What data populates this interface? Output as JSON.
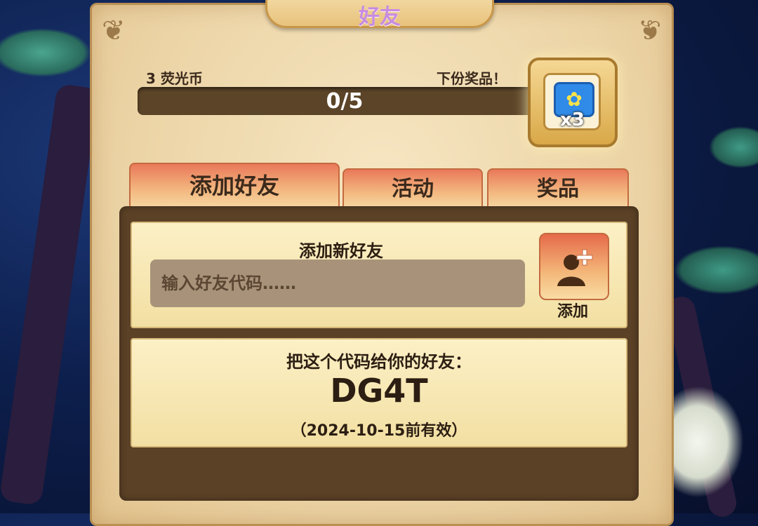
{
  "header": {
    "title": "好友"
  },
  "reward": {
    "currency_label": "3 荧光币",
    "next_label": "下份奖品！",
    "progress_text": "0/5",
    "progress_fraction": 0.0,
    "item_icon": "butterfly-icon",
    "item_count": "x3"
  },
  "tabs": [
    {
      "label": "添加好友",
      "active": true
    },
    {
      "label": "活动",
      "active": false
    },
    {
      "label": "奖品",
      "active": false
    }
  ],
  "add_friend": {
    "title": "添加新好友",
    "input_placeholder": "输入好友代码……",
    "input_value": "",
    "button_label": "添加",
    "button_icon": "add-person-icon"
  },
  "my_code": {
    "title": "把这个代码给你的好友：",
    "code": "DG4T",
    "expiry": "（2024-10-15前有效）"
  },
  "colors": {
    "tab_accent": "#e9795a",
    "panel": "#ecd4a6",
    "content_bg": "#5b4126"
  }
}
